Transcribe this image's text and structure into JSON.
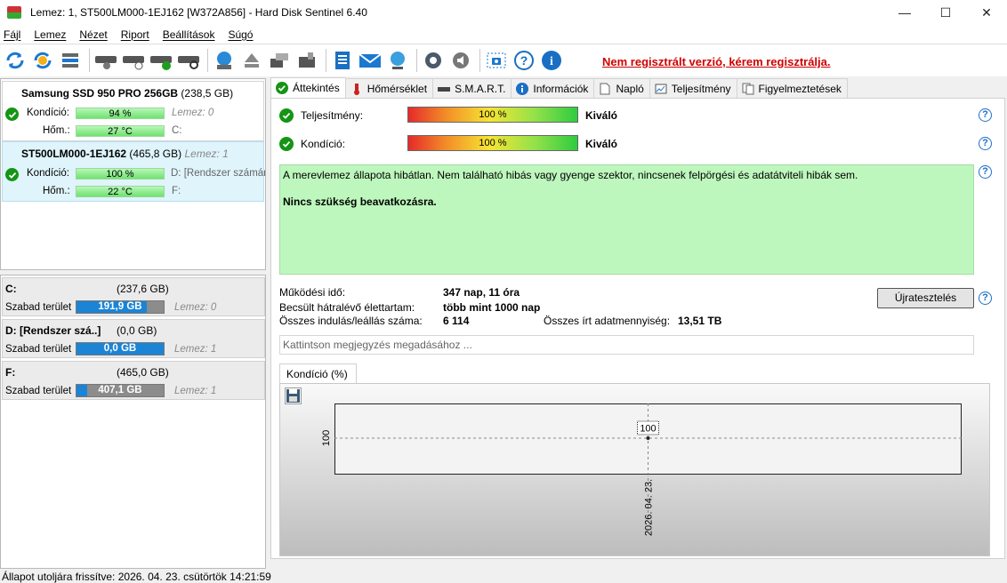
{
  "window": {
    "title": "Lemez: 1, ST500LM000-1EJ162 [W372A856]  -  Hard Disk Sentinel 6.40",
    "minimize": "—",
    "maximize": "☐",
    "close": "✕"
  },
  "menu": [
    "Fájl",
    "Lemez",
    "Nézet",
    "Riport",
    "Beállítások",
    "Súgó"
  ],
  "unregistered_link": "Nem regisztrált verzió, kérem regisztrálja.",
  "disks": [
    {
      "name": "Samsung SSD 950 PRO 256GB",
      "size": "(238,5 GB)",
      "lemez": "",
      "kondicio_label": "Kondíció:",
      "kondicio": "94 %",
      "kondicio_pct": 94,
      "note1": "Lemez: 0",
      "hom_label": "Hőm.:",
      "hom": "27 °C",
      "note2": "C:"
    },
    {
      "name": "ST500LM000-1EJ162",
      "size": "(465,8 GB)",
      "lemez": "Lemez: 1",
      "kondicio_label": "Kondíció:",
      "kondicio": "100 %",
      "kondicio_pct": 100,
      "note1": "D: [Rendszer számár",
      "hom_label": "Hőm.:",
      "hom": "22 °C",
      "note2": "F:"
    }
  ],
  "partitions": [
    {
      "name": "C:",
      "size": "(237,6 GB)",
      "free_label": "Szabad terület",
      "free": "191,9 GB",
      "free_fraction": 0.81,
      "lemez": "Lemez: 0"
    },
    {
      "name": "D: [Rendszer szá..]",
      "size": "(0,0 GB)",
      "free_label": "Szabad terület",
      "free": "0,0 GB",
      "free_fraction": 1.0,
      "lemez": "Lemez: 1"
    },
    {
      "name": "F:",
      "size": "(465,0 GB)",
      "free_label": "Szabad terület",
      "free": "407,1 GB",
      "free_fraction": 0.12,
      "lemez": "Lemez: 1"
    }
  ],
  "tabs": [
    "Áttekintés",
    "Hőmérséklet",
    "S.M.A.R.T.",
    "Információk",
    "Napló",
    "Teljesítmény",
    "Figyelmeztetések"
  ],
  "overview": {
    "teljesitmeny_label": "Teljesítmény:",
    "teljesitmeny": "100 %",
    "teljesitmeny_rating": "Kiváló",
    "kondicio_label": "Kondíció:",
    "kondicio": "100 %",
    "kondicio_rating": "Kiváló",
    "status_text": "A merevlemez állapota hibátlan. Nem található hibás vagy gyenge szektor, nincsenek felpörgési és adatátviteli hibák sem.",
    "status_action": "Nincs szükség beavatkozásra.",
    "uptime_label": "Működési idő:",
    "uptime": "347 nap, 11 óra",
    "lifetime_label": "Becsült hátralévő élettartam:",
    "lifetime": "több mint 1000 nap",
    "startstop_label": "Összes indulás/leállás száma:",
    "startstop": "6 114",
    "written_label": "Összes írt adatmennyiség:",
    "written": "13,51 TB",
    "retest_button": "Újratesztelés",
    "note_placeholder": "Kattintson megjegyzés megadásához ..."
  },
  "chart_tab": "Kondíció  (%)",
  "chart_data": {
    "type": "line",
    "x": [
      "2026. 04. 23."
    ],
    "series": [
      {
        "values": [
          100
        ]
      }
    ],
    "ylabel": "100",
    "data_labels": [
      "100"
    ]
  },
  "status_bar": "Állapot utoljára frissítve: 2026. 04. 23. csütörtök 14:21:59"
}
